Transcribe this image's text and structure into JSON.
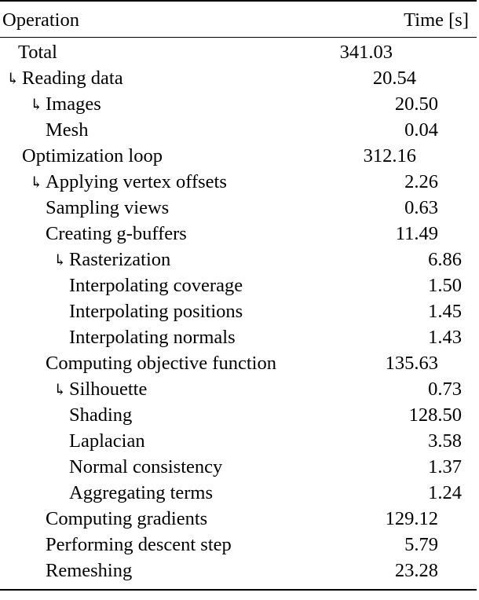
{
  "table": {
    "columns": {
      "operation": "Operation",
      "time": "Time [s]"
    },
    "arrow_glyph": "↳",
    "rows": [
      {
        "label": "Total",
        "value": "341.03",
        "depth": 0,
        "arrow": false
      },
      {
        "label": "Reading data",
        "value": "20.54",
        "depth": 1,
        "arrow": true
      },
      {
        "label": "Images",
        "value": "20.50",
        "depth": 2,
        "arrow": true
      },
      {
        "label": "Mesh",
        "value": "0.04",
        "depth": 2,
        "arrow": false
      },
      {
        "label": "Optimization loop",
        "value": "312.16",
        "depth": 1,
        "arrow": false
      },
      {
        "label": "Applying vertex offsets",
        "value": "2.26",
        "depth": 2,
        "arrow": true
      },
      {
        "label": "Sampling views",
        "value": "0.63",
        "depth": 2,
        "arrow": false
      },
      {
        "label": "Creating g-buffers",
        "value": "11.49",
        "depth": 2,
        "arrow": false
      },
      {
        "label": "Rasterization",
        "value": "6.86",
        "depth": 3,
        "arrow": true
      },
      {
        "label": "Interpolating coverage",
        "value": "1.50",
        "depth": 3,
        "arrow": false
      },
      {
        "label": "Interpolating positions",
        "value": "1.45",
        "depth": 3,
        "arrow": false
      },
      {
        "label": "Interpolating normals",
        "value": "1.43",
        "depth": 3,
        "arrow": false
      },
      {
        "label": "Computing objective function",
        "value": "135.63",
        "depth": 2,
        "arrow": false
      },
      {
        "label": "Silhouette",
        "value": "0.73",
        "depth": 3,
        "arrow": true
      },
      {
        "label": "Shading",
        "value": "128.50",
        "depth": 3,
        "arrow": false
      },
      {
        "label": "Laplacian",
        "value": "3.58",
        "depth": 3,
        "arrow": false
      },
      {
        "label": "Normal consistency",
        "value": "1.37",
        "depth": 3,
        "arrow": false
      },
      {
        "label": "Aggregating terms",
        "value": "1.24",
        "depth": 3,
        "arrow": false
      },
      {
        "label": "Computing gradients",
        "value": "129.12",
        "depth": 2,
        "arrow": false
      },
      {
        "label": "Performing descent step",
        "value": "5.79",
        "depth": 2,
        "arrow": false
      },
      {
        "label": "Remeshing",
        "value": "23.28",
        "depth": 2,
        "arrow": false
      }
    ]
  }
}
